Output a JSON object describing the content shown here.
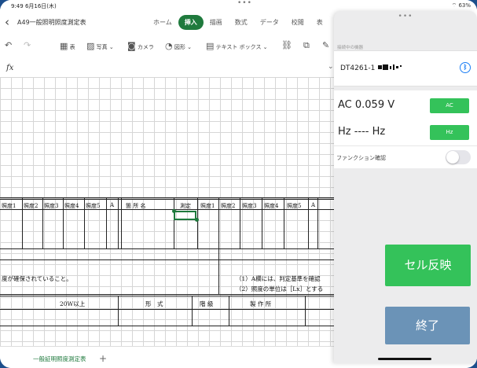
{
  "status_bar": {
    "time": "9:49  6月16日(木)",
    "battery": "63%"
  },
  "title_bar": {
    "document_title": "A49一般照明照度測定表",
    "tabs": [
      {
        "label": "ホーム",
        "active": false
      },
      {
        "label": "挿入",
        "active": true
      },
      {
        "label": "描画",
        "active": false
      },
      {
        "label": "数式",
        "active": false
      },
      {
        "label": "データ",
        "active": false
      },
      {
        "label": "校閲",
        "active": false
      },
      {
        "label": "表",
        "active": false
      }
    ]
  },
  "ribbon": {
    "table_label": "表",
    "photo_label": "写真",
    "camera_label": "カメラ",
    "shapes_label": "図形",
    "textbox_label": "テキスト ボックス"
  },
  "formula_bar": {
    "fx": "fx"
  },
  "sheet": {
    "headers": [
      "照度1",
      "照度2",
      "照度3",
      "照度4",
      "照度5",
      "A",
      "箇 所 名",
      "測定",
      "照度1",
      "照度2",
      "照度3",
      "照度4",
      "照度5",
      "A"
    ],
    "note_left": "度が確保されていること。",
    "note_right_1": "（1）A欄には、判定基準を確認",
    "note_right_2": "（2）照度の単位は［Lx］とする",
    "footer_row": {
      "c1": "20W以上",
      "c2": "形　式",
      "c3": "階 級",
      "c4": "製 作 所"
    }
  },
  "sheet_tabs": [
    {
      "label": "一般証明照度測定表",
      "active": true
    }
  ],
  "panel": {
    "caption": "接続中の機器",
    "device_name": "DT4261-1",
    "measurement_1": {
      "label": "AC 0.059 V",
      "button": "AC"
    },
    "measurement_2": {
      "label": "Hz ---- Hz",
      "button": "Hz"
    },
    "function_check_label": "ファンクション確認",
    "function_check_on": false,
    "reflect_button": "セル反映",
    "end_button": "終了"
  },
  "colors": {
    "accent_green": "#1f7a3d",
    "button_green": "#34c25a",
    "end_blue": "#6b93b7",
    "bluetooth_blue": "#1a7ef5"
  }
}
